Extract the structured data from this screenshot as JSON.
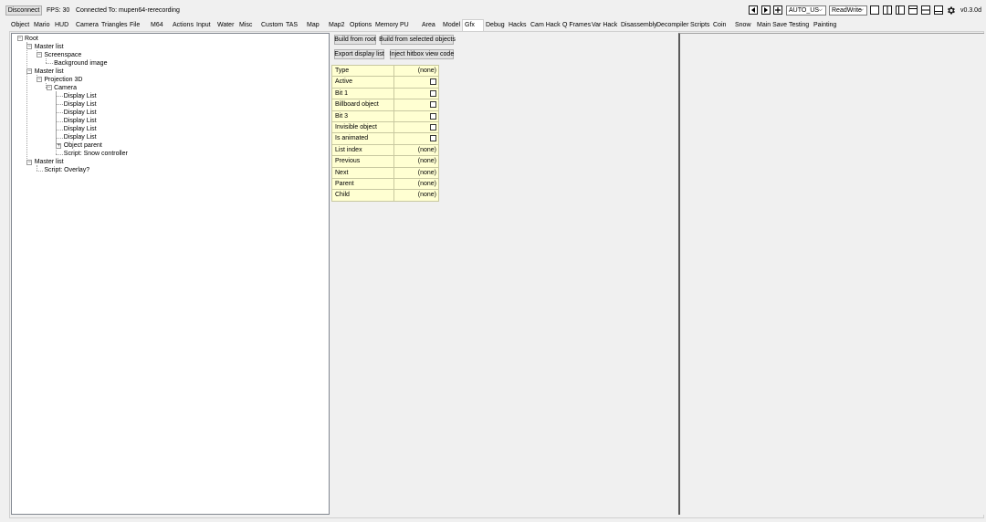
{
  "toolbar": {
    "disconnect_label": "Disconnect",
    "fps_text": "FPS: 30",
    "connected_text": "Connected To: mupen64-rerecording",
    "region_value": "AUTO_US",
    "access_value": "ReadWrite",
    "version_text": "v0.3.0d"
  },
  "tabs": [
    {
      "label": "Object"
    },
    {
      "label": "Mario"
    },
    {
      "label": "HUD"
    },
    {
      "label": "Camera"
    },
    {
      "label": "Triangles"
    },
    {
      "label": "File"
    },
    {
      "label": "M64"
    },
    {
      "label": "Actions"
    },
    {
      "label": "Input"
    },
    {
      "label": "Water"
    },
    {
      "label": "Misc"
    },
    {
      "label": "Custom"
    },
    {
      "label": "TAS"
    },
    {
      "label": "Map"
    },
    {
      "label": "Map2"
    },
    {
      "label": "Options"
    },
    {
      "label": "Memory"
    },
    {
      "label": "PU"
    },
    {
      "label": "Area"
    },
    {
      "label": "Model"
    },
    {
      "label": "Gfx"
    },
    {
      "label": "Debug"
    },
    {
      "label": "Hacks"
    },
    {
      "label": "Cam Hack"
    },
    {
      "label": "Q Frames"
    },
    {
      "label": "Var Hack"
    },
    {
      "label": "Disassembly"
    },
    {
      "label": "Decompiler"
    },
    {
      "label": "Scripts"
    },
    {
      "label": "Coin"
    },
    {
      "label": "Snow"
    },
    {
      "label": "Main Save"
    },
    {
      "label": "Testing"
    },
    {
      "label": "Painting"
    }
  ],
  "active_tab": "Gfx",
  "gfx": {
    "build_root_label": "Build from root",
    "build_selected_label": "Build from selected objects",
    "export_label": "Export display list",
    "inject_label": "Inject hitbox view code"
  },
  "tree": [
    {
      "label": "Root",
      "expander": "minus"
    },
    {
      "label": "Master list",
      "expander": "minus"
    },
    {
      "label": "Screenspace",
      "expander": "minus"
    },
    {
      "label": "Background image",
      "expander": ""
    },
    {
      "label": "Master list",
      "expander": "minus"
    },
    {
      "label": "Projection 3D",
      "expander": "minus"
    },
    {
      "label": "Camera",
      "expander": "minus"
    },
    {
      "label": "Display List",
      "expander": ""
    },
    {
      "label": "Display List",
      "expander": ""
    },
    {
      "label": "Display List",
      "expander": ""
    },
    {
      "label": "Display List",
      "expander": ""
    },
    {
      "label": "Display List",
      "expander": ""
    },
    {
      "label": "Display List",
      "expander": ""
    },
    {
      "label": "Object parent",
      "expander": "plus"
    },
    {
      "label": "Script: Snow controller",
      "expander": ""
    },
    {
      "label": "Master list",
      "expander": "minus"
    },
    {
      "label": "Script: Overlay?",
      "expander": ""
    }
  ],
  "properties": [
    {
      "name": "Type",
      "value": "(none)",
      "checkbox": false
    },
    {
      "name": "Active",
      "value": "",
      "checkbox": true
    },
    {
      "name": "Bit 1",
      "value": "",
      "checkbox": true
    },
    {
      "name": "Billboard object",
      "value": "",
      "checkbox": true
    },
    {
      "name": "Bit 3",
      "value": "",
      "checkbox": true
    },
    {
      "name": "Invisible object",
      "value": "",
      "checkbox": true
    },
    {
      "name": "Is animated",
      "value": "",
      "checkbox": true
    },
    {
      "name": "List index",
      "value": "(none)",
      "checkbox": false
    },
    {
      "name": "Previous",
      "value": "(none)",
      "checkbox": false
    },
    {
      "name": "Next",
      "value": "(none)",
      "checkbox": false
    },
    {
      "name": "Parent",
      "value": "(none)",
      "checkbox": false
    },
    {
      "name": "Child",
      "value": "(none)",
      "checkbox": false
    }
  ]
}
